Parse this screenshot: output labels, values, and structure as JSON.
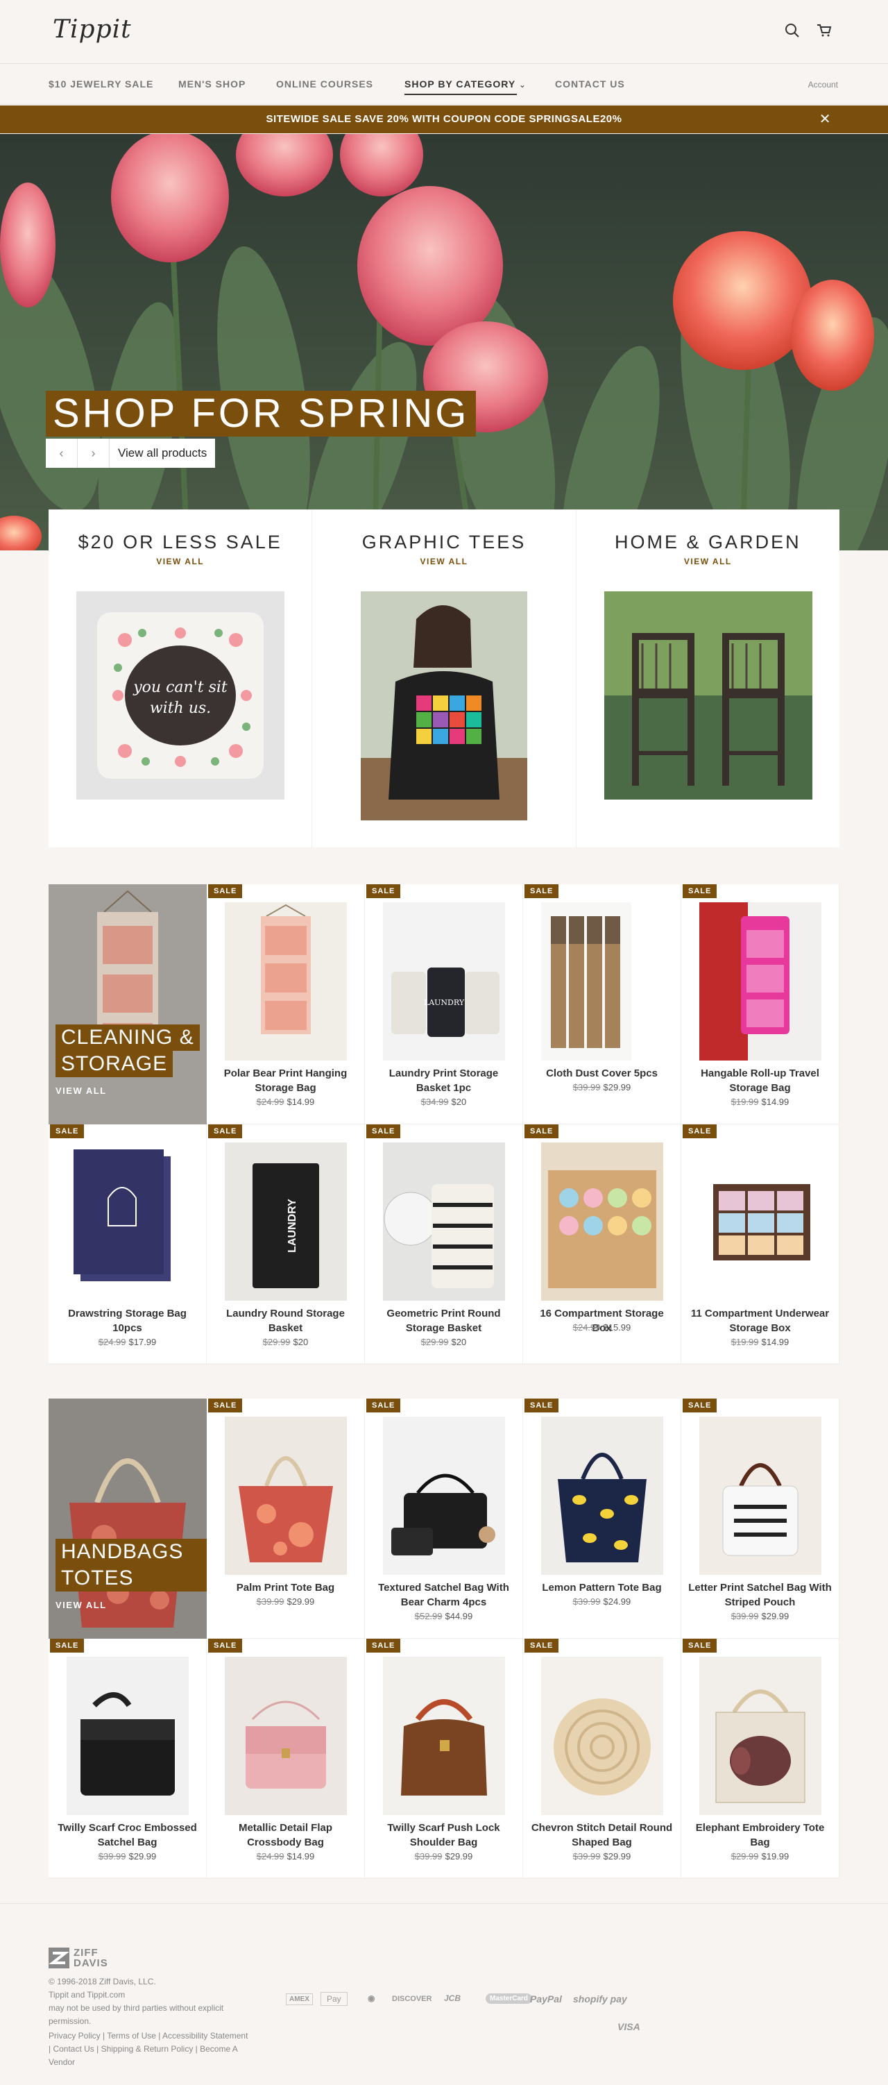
{
  "header": {
    "logo": "Tippit",
    "search_icon": "search-icon",
    "cart_icon": "cart-icon"
  },
  "nav": {
    "items": [
      "$10 JEWELRY SALE",
      "MEN'S SHOP",
      "ONLINE COURSES",
      "SHOP BY CATEGORY",
      "CONTACT US"
    ],
    "dropdown_indicator": "⌄",
    "account": "Account"
  },
  "banner": {
    "text": "SITEWIDE SALE SAVE 20% WITH COUPON CODE SPRINGSALE20%",
    "close": "✕"
  },
  "hero": {
    "title": "SHOP FOR SPRING",
    "prev": "‹",
    "next": "›",
    "cta": "View all products"
  },
  "categories": [
    {
      "title": "$20 OR LESS SALE",
      "link": "VIEW ALL",
      "pillow_text": "you can't sit with us."
    },
    {
      "title": "GRAPHIC TEES",
      "link": "VIEW ALL"
    },
    {
      "title": "HOME & GARDEN",
      "link": "VIEW ALL"
    }
  ],
  "sale_badge": "SALE",
  "collection1": {
    "title_lines": [
      "CLEANING &",
      "STORAGE"
    ],
    "link": "VIEW ALL",
    "products": [
      {
        "name": "Polar Bear Print Hanging Storage Bag",
        "old": "$24.99",
        "price": "$14.99"
      },
      {
        "name": "Laundry Print Storage Basket 1pc",
        "old": "$34.99",
        "price": "$20"
      },
      {
        "name": "Cloth Dust Cover 5pcs",
        "old": "$39.99",
        "price": "$29.99"
      },
      {
        "name": "Hangable Roll-up Travel Storage Bag",
        "old": "$19.99",
        "price": "$14.99"
      },
      {
        "name": "Drawstring Storage Bag 10pcs",
        "old": "$24.99",
        "price": "$17.99"
      },
      {
        "name": "Laundry Round Storage Basket",
        "old": "$29.99",
        "price": "$20"
      },
      {
        "name": "Geometric Print Round Storage Basket",
        "old": "$29.99",
        "price": "$20"
      },
      {
        "name": "16 Compartment Storage Box",
        "old": "$24.99",
        "price": "$15.99"
      },
      {
        "name": "11 Compartment Underwear Storage Box",
        "old": "$19.99",
        "price": "$14.99"
      }
    ]
  },
  "collection2": {
    "title_lines": [
      "HANDBAGS &",
      "TOTES"
    ],
    "link": "VIEW ALL",
    "products": [
      {
        "name": "Palm Print Tote Bag",
        "old": "$39.99",
        "price": "$29.99"
      },
      {
        "name": "Textured Satchel Bag With Bear Charm 4pcs",
        "old": "$52.99",
        "price": "$44.99"
      },
      {
        "name": "Lemon Pattern Tote Bag",
        "old": "$39.99",
        "price": "$24.99"
      },
      {
        "name": "Letter Print Satchel Bag With Striped Pouch",
        "old": "$39.99",
        "price": "$29.99"
      },
      {
        "name": "Twilly Scarf Croc Embossed Satchel Bag",
        "old": "$39.99",
        "price": "$29.99"
      },
      {
        "name": "Metallic Detail Flap Crossbody Bag",
        "old": "$24.99",
        "price": "$14.99"
      },
      {
        "name": "Twilly Scarf Push Lock Shoulder Bag",
        "old": "$39.99",
        "price": "$29.99"
      },
      {
        "name": "Chevron Stitch Detail Round Shaped Bag",
        "old": "$39.99",
        "price": "$29.99"
      },
      {
        "name": "Elephant Embroidery Tote Bag",
        "old": "$29.99",
        "price": "$19.99"
      }
    ]
  },
  "footer": {
    "brand_top": "ZIFF",
    "brand_bottom": "DAVIS",
    "copyright": "© 1996-2018 Ziff Davis, LLC.",
    "line2": "Tippit and Tippit.com",
    "line3": "may not be used by third parties without explicit permission.",
    "links": "Privacy Policy | Terms of Use | Accessibility Statement | Contact Us | Shipping & Return Policy | Become A Vendor",
    "payments": [
      "AMEX",
      "Pay",
      "◉",
      "DISCOVER",
      "JCB",
      "MasterCard",
      "PayPal",
      "shopify pay",
      "VISA"
    ]
  }
}
